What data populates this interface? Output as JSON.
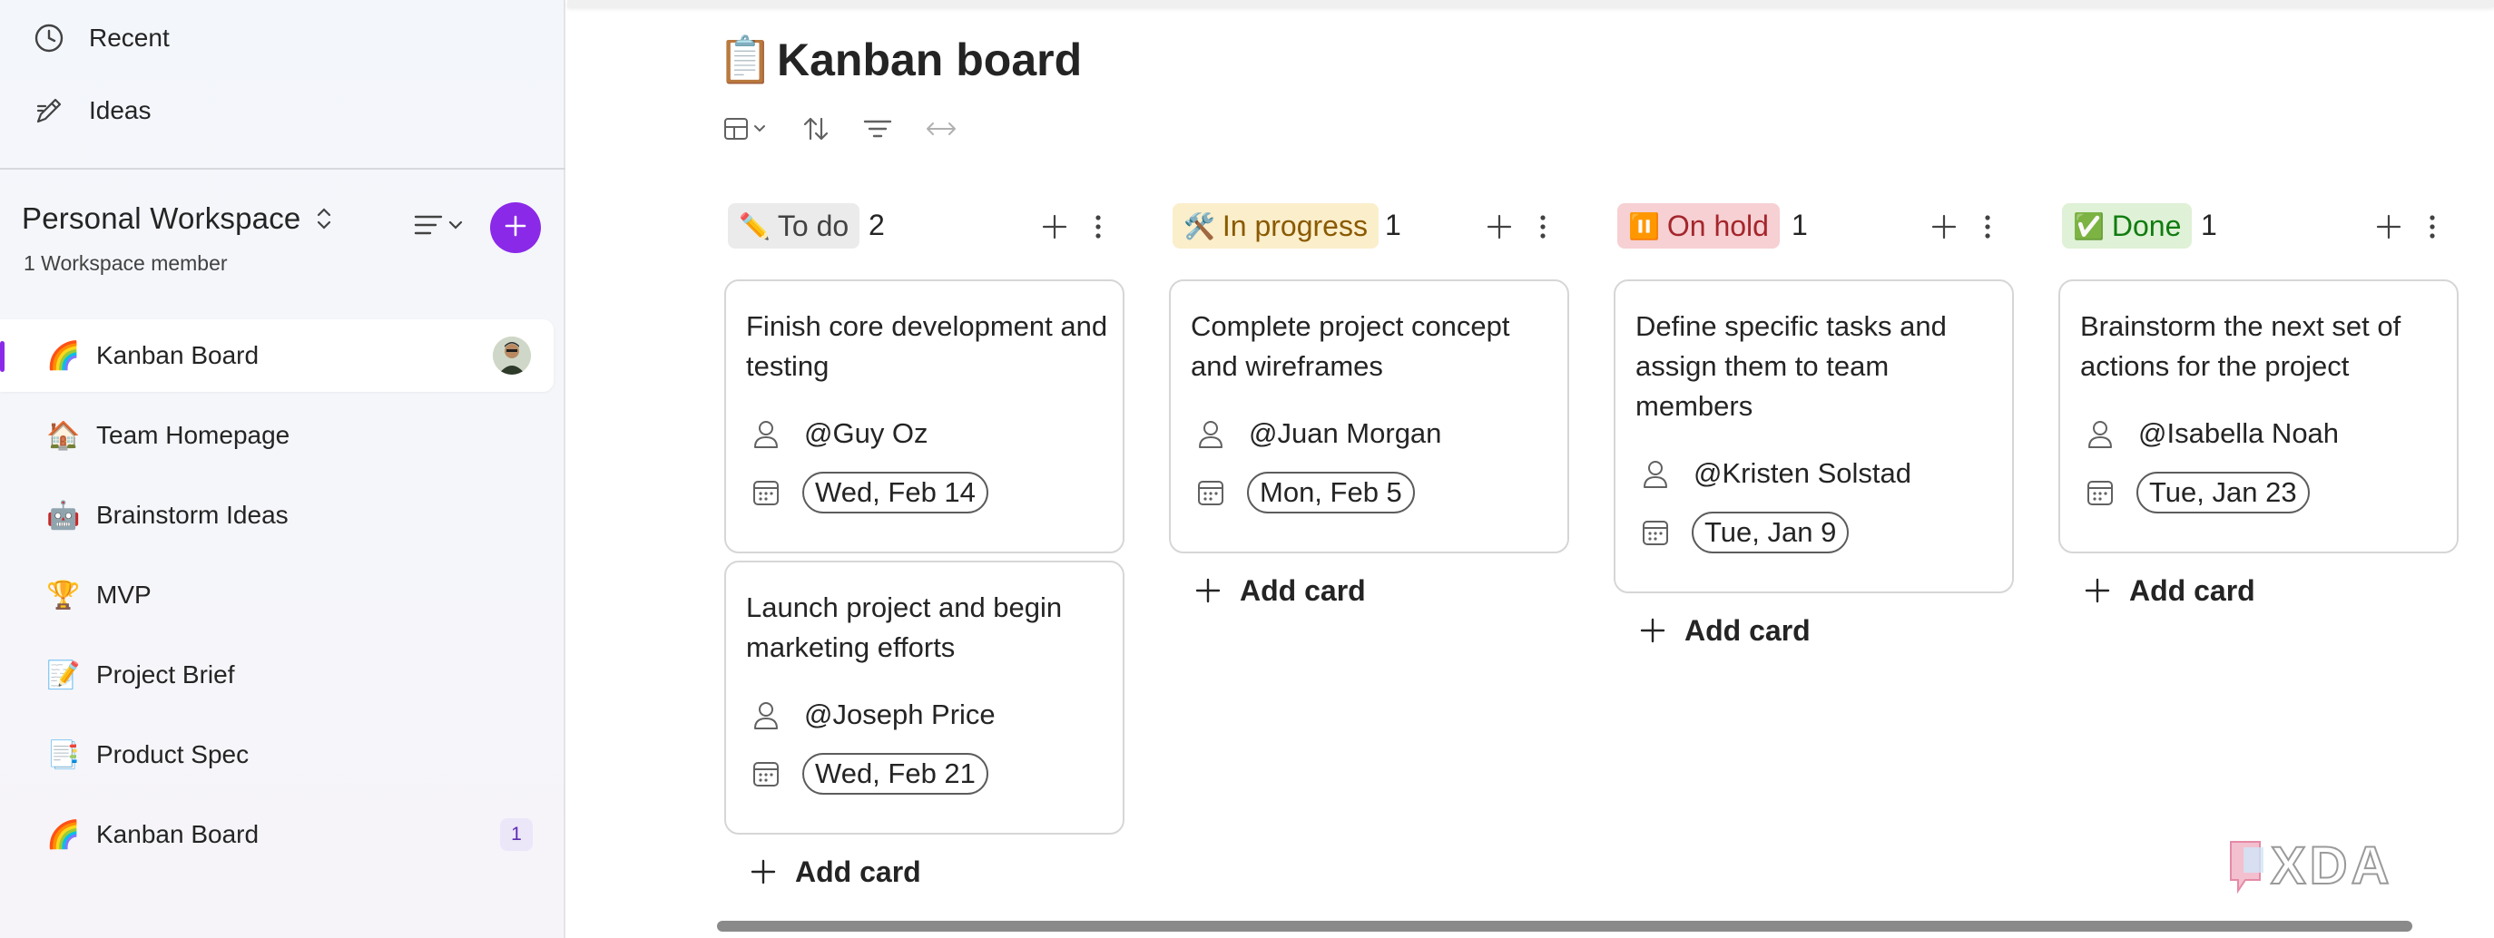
{
  "sidebar": {
    "top_items": [
      {
        "label": "Recent",
        "icon": "clock-icon"
      },
      {
        "label": "Ideas",
        "icon": "pencil-icon"
      }
    ],
    "workspace": {
      "title": "Personal Workspace",
      "members": "1 Workspace member"
    },
    "pages": [
      {
        "label": "Kanban Board",
        "icon": "rainbow-icon",
        "emoji": "🌈",
        "active": true
      },
      {
        "label": "Team Homepage",
        "icon": "house-icon",
        "emoji": "🏠"
      },
      {
        "label": "Brainstorm Ideas",
        "icon": "robot-icon",
        "emoji": "🤖"
      },
      {
        "label": "MVP",
        "icon": "trophy-icon",
        "emoji": "🏆"
      },
      {
        "label": "Project Brief",
        "icon": "memo-icon",
        "emoji": "📝"
      },
      {
        "label": "Product Spec",
        "icon": "document-icon",
        "emoji": "📑"
      },
      {
        "label": "Kanban Board",
        "icon": "rainbow-icon",
        "emoji": "🌈",
        "badge": "1"
      }
    ]
  },
  "main": {
    "title_emoji": "📋",
    "title": "Kanban board",
    "columns": [
      {
        "name": "To do",
        "emoji": "✏️",
        "count": "2",
        "tag_bg": "#ebebeb",
        "tag_color": "#424242",
        "cards": [
          {
            "title": "Finish core development and testing",
            "assignee": "@Guy Oz",
            "date": "Wed, Feb 14"
          },
          {
            "title": "Launch project and begin marketing efforts",
            "assignee": "@Joseph Price",
            "date": "Wed, Feb 21"
          }
        ],
        "add_label": "Add card"
      },
      {
        "name": "In progress",
        "emoji": "🛠️",
        "count": "1",
        "tag_bg": "#fbeecb",
        "tag_color": "#8a5a00",
        "cards": [
          {
            "title": "Complete project concept and wireframes",
            "assignee": "@Juan Morgan",
            "date": "Mon, Feb 5"
          }
        ],
        "add_label": "Add card"
      },
      {
        "name": "On hold",
        "emoji": "⏸️",
        "count": "1",
        "tag_bg": "#f6d0d3",
        "tag_color": "#a4262c",
        "cards": [
          {
            "title": "Define specific tasks and assign them to team members",
            "assignee": "@Kristen Solstad",
            "date": "Tue, Jan 9"
          }
        ],
        "add_label": "Add card"
      },
      {
        "name": "Done",
        "emoji": "✅",
        "count": "1",
        "tag_bg": "#dff1d6",
        "tag_color": "#107c10",
        "cards": [
          {
            "title": "Brainstorm the next set of actions for the project",
            "assignee": "@Isabella Noah",
            "date": "Tue, Jan 23"
          }
        ],
        "add_label": "Add card"
      }
    ]
  },
  "colors": {
    "accent": "#8b29e8",
    "border": "#d6d6d6"
  },
  "watermark": "XDA"
}
